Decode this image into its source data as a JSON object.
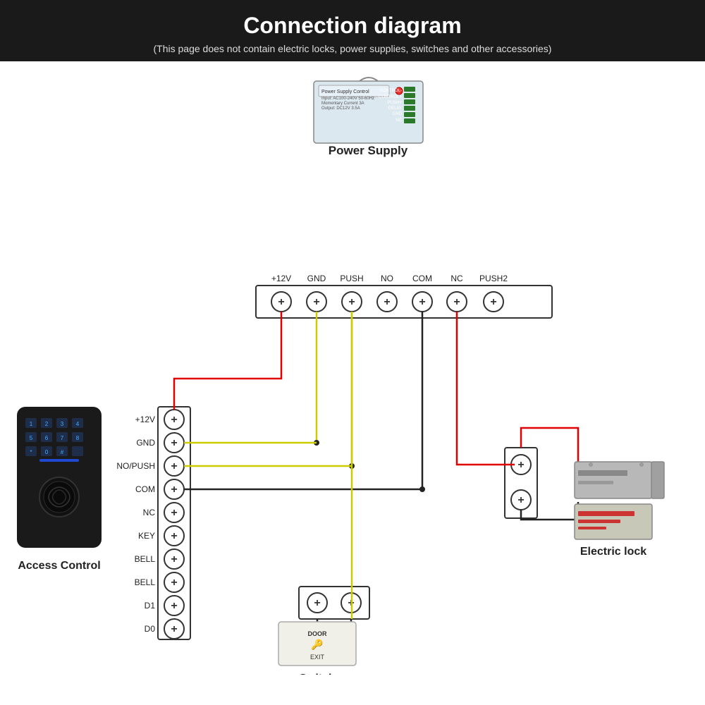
{
  "header": {
    "title": "Connection diagram",
    "subtitle": "(This page does not contain electric locks, power supplies, switches and other accessories)"
  },
  "power_supply": {
    "label": "Power Supply",
    "terminals": [
      "+12V",
      "GND",
      "PUSH",
      "NO",
      "COM",
      "NC",
      "PUSH2"
    ]
  },
  "access_control": {
    "label": "Access Control",
    "terminals": [
      "+12V",
      "GND",
      "NO/PUSH",
      "COM",
      "NC",
      "KEY",
      "BELL",
      "BELL",
      "D1",
      "D0"
    ]
  },
  "switch_device": {
    "label": "Switch",
    "text_door": "DOOR",
    "text_exit": "EXIT"
  },
  "electric_lock": {
    "label": "Electric lock"
  },
  "wire_colors": {
    "red": "#e00000",
    "yellow": "#ddcc00",
    "black": "#222222",
    "blue": "#2255cc"
  }
}
